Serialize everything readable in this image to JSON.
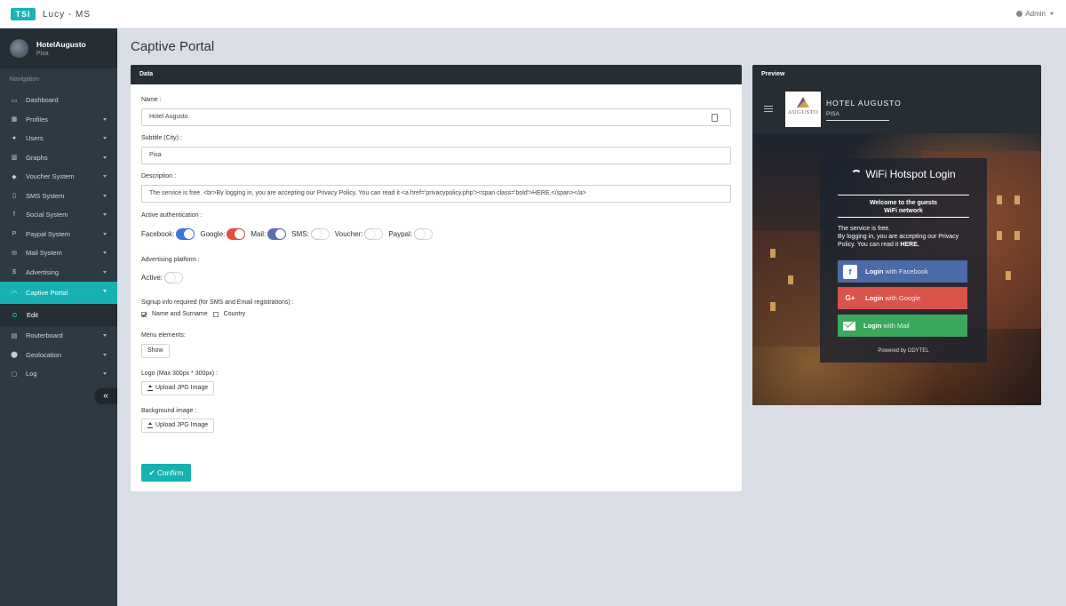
{
  "app": {
    "logo": "TSI",
    "name": "Lucy - MS"
  },
  "user_menu": {
    "label": "Admin",
    "icon": "user-icon"
  },
  "sidebar": {
    "profile": {
      "name": "HotelAugusto",
      "city": "Pisa"
    },
    "heading": "Navigation",
    "items": [
      {
        "label": "Dashboard",
        "icon": "laptop-icon",
        "has_caret": false
      },
      {
        "label": "Profiles",
        "icon": "grid-icon",
        "has_caret": true
      },
      {
        "label": "Users",
        "icon": "users-icon",
        "has_caret": true
      },
      {
        "label": "Graphs",
        "icon": "bar-chart-icon",
        "has_caret": true
      },
      {
        "label": "Voucher System",
        "icon": "ticket-icon",
        "has_caret": true
      },
      {
        "label": "SMS System",
        "icon": "mobile-icon",
        "has_caret": true
      },
      {
        "label": "Social System",
        "icon": "facebook-icon",
        "has_caret": true
      },
      {
        "label": "Paypal System",
        "icon": "paypal-icon",
        "has_caret": true
      },
      {
        "label": "Mail System",
        "icon": "envelope-icon",
        "has_caret": true
      },
      {
        "label": "Advertising",
        "icon": "dollar-icon",
        "has_caret": true
      },
      {
        "label": "Captive Portal",
        "icon": "wifi-icon",
        "has_caret": true,
        "active": true
      },
      {
        "label": "Routerboard",
        "icon": "server-icon",
        "has_caret": true
      },
      {
        "label": "Geolocation",
        "icon": "map-marker-icon",
        "has_caret": true
      },
      {
        "label": "Log",
        "icon": "file-icon",
        "has_caret": true
      }
    ],
    "sub_item": "Edit",
    "collapse_label": "«"
  },
  "page": {
    "title": "Captive Portal"
  },
  "data_panel": {
    "header": "Data",
    "name_label": "Name :",
    "name_value": "Hotel Augusto",
    "subtitle_label": "Subtitle (City) :",
    "subtitle_value": "Pisa",
    "description_label": "Description :",
    "description_value": "The service is free. <br>By logging in, you are accepting our Privacy Policy. You can read it <a href='privacypolicy.php'><span class='bold'>HERE.</span></a>",
    "auth_label": "Active authentication :",
    "auth_toggles": [
      {
        "label": "Facebook:",
        "on": true,
        "color": "#3a78d8"
      },
      {
        "label": "Google:",
        "on": true,
        "color": "#e74c3c"
      },
      {
        "label": "Mail:",
        "on": true,
        "color": "#5b6fb0"
      },
      {
        "label": "SMS:",
        "on": false,
        "color": "#ffffff"
      },
      {
        "label": "Voucher:",
        "on": false,
        "color": "#ffffff"
      },
      {
        "label": "Paypal:",
        "on": false,
        "color": "#ffffff"
      }
    ],
    "adv_label": "Advertising platform :",
    "adv_active_label": "Active:",
    "adv_active_on": false,
    "signup_label": "Signup info required (for SMS and Email registrations) :",
    "signup_options": [
      {
        "label": "Name and Surname",
        "checked": true
      },
      {
        "label": "Country",
        "checked": false
      }
    ],
    "menu_label": "Menu elements:",
    "menu_button": "Show",
    "logo_label": "Logo (Max 300px * 300px) :",
    "logo_button": "Upload JPG Image",
    "bg_label": "Background image :",
    "bg_button": "Upload JPG Image",
    "confirm_button": "Confirm",
    "accent": "#17b1b1"
  },
  "preview": {
    "header": "Preview",
    "logo_word": "AUGUSTO",
    "hotel_name": "HOTEL AUGUSTO",
    "hotel_city": "PISA",
    "login_title": "WiFi Hotspot Login",
    "welcome_line1": "Welcome to the guests",
    "welcome_line2": "WiFi network",
    "desc_line1": "The service is free.",
    "desc_line2": "By logging in, you are accepting our Privacy Policy. You can read it ",
    "desc_link": "HERE.",
    "buttons": [
      {
        "prefix": "Login",
        "suffix": " with Facebook",
        "icon": "facebook-icon",
        "color": "#4a6aa8"
      },
      {
        "prefix": "Login",
        "suffix": " with Google",
        "icon": "google-plus-icon",
        "color": "#d9534a"
      },
      {
        "prefix": "Login",
        "suffix": " with Mail",
        "icon": "envelope-icon",
        "color": "#3aa95e"
      }
    ],
    "powered_by": "Powered by ODYTEL"
  }
}
